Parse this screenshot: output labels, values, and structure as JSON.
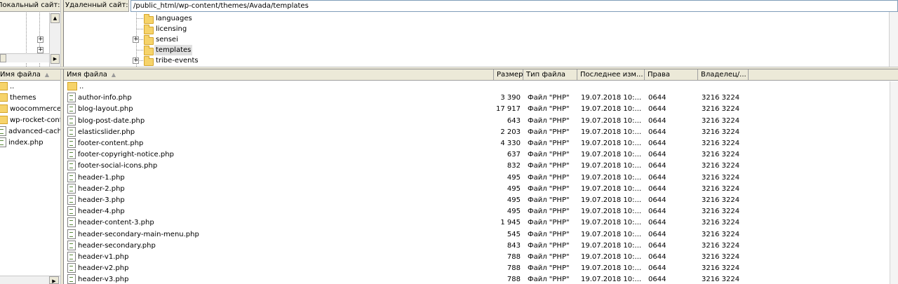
{
  "local": {
    "path_label": "Локальный сайт:",
    "column_name": "Имя файла",
    "items": [
      {
        "name": "..",
        "type": "folder"
      },
      {
        "name": "themes",
        "type": "folder"
      },
      {
        "name": "woocommerce",
        "type": "folder"
      },
      {
        "name": "wp-rocket-config",
        "type": "folder"
      },
      {
        "name": "advanced-cache.php",
        "type": "file"
      },
      {
        "name": "index.php",
        "type": "file"
      }
    ]
  },
  "remote": {
    "path_label": "Удаленный сайт:",
    "path_value": "/public_html/wp-content/themes/Avada/templates",
    "tree": [
      {
        "name": "languages",
        "expander": false,
        "selected": false
      },
      {
        "name": "licensing",
        "expander": false,
        "selected": false
      },
      {
        "name": "sensei",
        "expander": true,
        "selected": false
      },
      {
        "name": "templates",
        "expander": false,
        "selected": true
      },
      {
        "name": "tribe-events",
        "expander": true,
        "selected": false
      }
    ],
    "columns": {
      "name": "Имя файла",
      "size": "Размер",
      "type": "Тип файла",
      "modified": "Последнее изм...",
      "perms": "Права",
      "owner": "Владелец/..."
    },
    "files": [
      {
        "name": "..",
        "folder": true,
        "size": "",
        "type": "",
        "modified": "",
        "perms": "",
        "owner": ""
      },
      {
        "name": "author-info.php",
        "size": "3 390",
        "type": "Файл \"PHP\"",
        "modified": "19.07.2018 10:...",
        "perms": "0644",
        "owner": "3216 3224"
      },
      {
        "name": "blog-layout.php",
        "size": "17 917",
        "type": "Файл \"PHP\"",
        "modified": "19.07.2018 10:...",
        "perms": "0644",
        "owner": "3216 3224"
      },
      {
        "name": "blog-post-date.php",
        "size": "643",
        "type": "Файл \"PHP\"",
        "modified": "19.07.2018 10:...",
        "perms": "0644",
        "owner": "3216 3224"
      },
      {
        "name": "elasticslider.php",
        "size": "2 203",
        "type": "Файл \"PHP\"",
        "modified": "19.07.2018 10:...",
        "perms": "0644",
        "owner": "3216 3224"
      },
      {
        "name": "footer-content.php",
        "size": "4 330",
        "type": "Файл \"PHP\"",
        "modified": "19.07.2018 10:...",
        "perms": "0644",
        "owner": "3216 3224"
      },
      {
        "name": "footer-copyright-notice.php",
        "size": "637",
        "type": "Файл \"PHP\"",
        "modified": "19.07.2018 10:...",
        "perms": "0644",
        "owner": "3216 3224"
      },
      {
        "name": "footer-social-icons.php",
        "size": "832",
        "type": "Файл \"PHP\"",
        "modified": "19.07.2018 10:...",
        "perms": "0644",
        "owner": "3216 3224"
      },
      {
        "name": "header-1.php",
        "size": "495",
        "type": "Файл \"PHP\"",
        "modified": "19.07.2018 10:...",
        "perms": "0644",
        "owner": "3216 3224"
      },
      {
        "name": "header-2.php",
        "size": "495",
        "type": "Файл \"PHP\"",
        "modified": "19.07.2018 10:...",
        "perms": "0644",
        "owner": "3216 3224"
      },
      {
        "name": "header-3.php",
        "size": "495",
        "type": "Файл \"PHP\"",
        "modified": "19.07.2018 10:...",
        "perms": "0644",
        "owner": "3216 3224"
      },
      {
        "name": "header-4.php",
        "size": "495",
        "type": "Файл \"PHP\"",
        "modified": "19.07.2018 10:...",
        "perms": "0644",
        "owner": "3216 3224"
      },
      {
        "name": "header-content-3.php",
        "size": "1 945",
        "type": "Файл \"PHP\"",
        "modified": "19.07.2018 10:...",
        "perms": "0644",
        "owner": "3216 3224"
      },
      {
        "name": "header-secondary-main-menu.php",
        "size": "545",
        "type": "Файл \"PHP\"",
        "modified": "19.07.2018 10:...",
        "perms": "0644",
        "owner": "3216 3224"
      },
      {
        "name": "header-secondary.php",
        "size": "843",
        "type": "Файл \"PHP\"",
        "modified": "19.07.2018 10:...",
        "perms": "0644",
        "owner": "3216 3224"
      },
      {
        "name": "header-v1.php",
        "size": "788",
        "type": "Файл \"PHP\"",
        "modified": "19.07.2018 10:...",
        "perms": "0644",
        "owner": "3216 3224"
      },
      {
        "name": "header-v2.php",
        "size": "788",
        "type": "Файл \"PHP\"",
        "modified": "19.07.2018 10:...",
        "perms": "0644",
        "owner": "3216 3224"
      },
      {
        "name": "header-v3.php",
        "size": "788",
        "type": "Файл \"PHP\"",
        "modified": "19.07.2018 10:...",
        "perms": "0644",
        "owner": "3216 3224"
      }
    ]
  },
  "icons": {
    "folder": "folder-icon",
    "file": "php-file-icon",
    "expander": "tree-expand-plus-icon",
    "sort": "sort-ascending-icon"
  },
  "colors": {
    "chrome": "#ece9d8",
    "folder": "#f6d36a",
    "selection": "#e0e0e0"
  }
}
